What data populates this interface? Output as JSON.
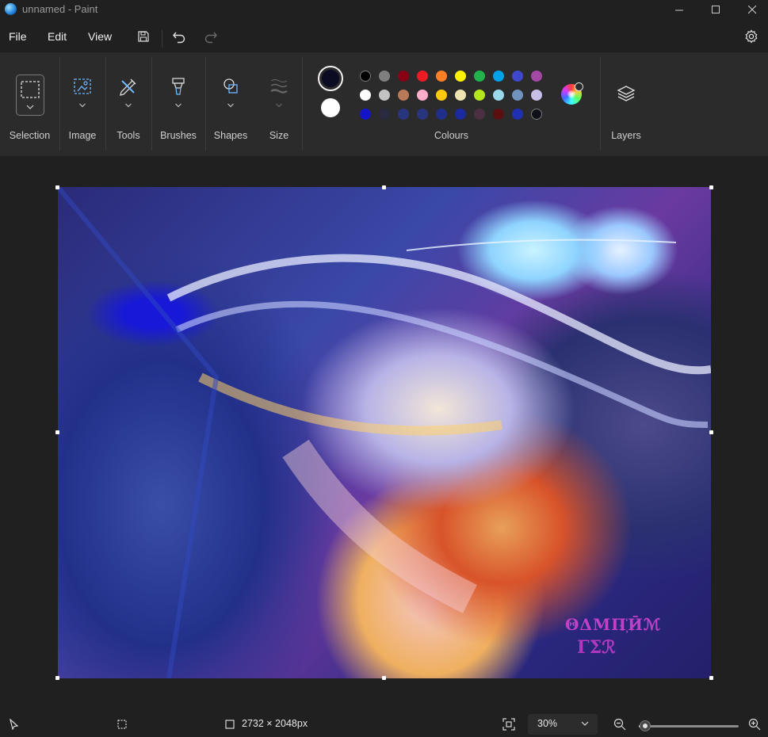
{
  "window": {
    "title": "unnamed - Paint",
    "app_icon": "paint-globe-icon",
    "controls": [
      "minimize-icon",
      "maximize-icon",
      "close-icon"
    ]
  },
  "menu": {
    "items": [
      "File",
      "Edit",
      "View"
    ],
    "quick_actions": [
      "save-icon",
      "undo-icon",
      "redo-icon"
    ],
    "settings_icon": "gear-icon"
  },
  "ribbon": {
    "groups": [
      {
        "label": "Selection",
        "icon": "selection-rectangle-icon"
      },
      {
        "label": "Image",
        "icon": "image-icon"
      },
      {
        "label": "Tools",
        "icon": "pencil-eraser-icon"
      },
      {
        "label": "Brushes",
        "icon": "brush-icon"
      },
      {
        "label": "Shapes",
        "icon": "shapes-icon"
      },
      {
        "label": "Size",
        "icon": "line-size-icon"
      }
    ],
    "colours_label": "Colours",
    "layers_label": "Layers",
    "primary_colour": "#0b0b24",
    "secondary_colour": "#ffffff",
    "palette": [
      [
        "#000000",
        "#7f7f7f",
        "#880015",
        "#ed1c24",
        "#ff7f27",
        "#fff200",
        "#22b14c",
        "#00a2e8",
        "#3f48cc",
        "#a349a4"
      ],
      [
        "#ffffff",
        "#c3c3c3",
        "#b97a57",
        "#ffaec9",
        "#ffc90e",
        "#efe4b0",
        "#b5e61d",
        "#99d9ea",
        "#7092be",
        "#c8bfe7"
      ],
      [
        "#1414c8",
        "#2a2a40",
        "#2a3580",
        "#2a3580",
        "#20308a",
        "#1c2aa0",
        "#4a3040",
        "#5a1010",
        "#2030b0",
        "#101018"
      ]
    ]
  },
  "canvas": {
    "signature_line1": "ΘΔΜΠ҉Ӣℳ",
    "signature_line2": "ΓΣℛ"
  },
  "status": {
    "pointer_icon": "cursor-icon",
    "selection_icon": "selection-size-icon",
    "canvas_size_icon": "canvas-size-icon",
    "dimensions": "2732 × 2048px",
    "fit_icon": "fit-to-window-icon",
    "zoom": "30%",
    "zoom_level": 0.06
  }
}
